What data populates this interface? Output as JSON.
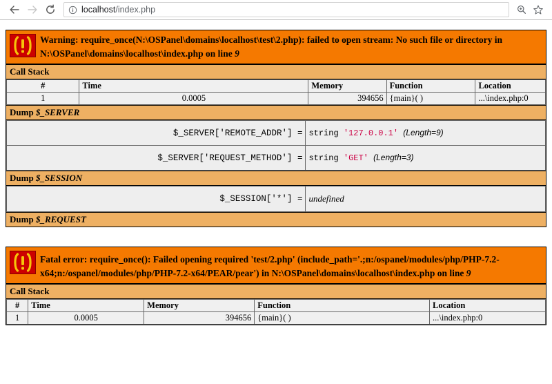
{
  "browser": {
    "back_label": "Back",
    "forward_label": "Forward",
    "reload_label": "Reload",
    "site_info_label": "View site information",
    "url_host": "localhost",
    "url_path": "/index.php",
    "zoom_icon_label": "Zoom",
    "bookmark_icon_label": "Bookmark this page"
  },
  "colors": {
    "error_banner_bg": "#f57900",
    "section_head_bg": "#eeb063",
    "icon_bg": "#cc0000",
    "icon_fg": "#f5c40a",
    "string_value": "#cc0044",
    "table_bg": "#f0f0f0"
  },
  "blocks": [
    {
      "id": "warning-block",
      "icon": "error-exclamation-icon",
      "message_prefix": "Warning: require_once(N:\\OSPanel\\domains\\localhost\\test\\2.php): failed to open stream: No such file or directory in N:\\OSPanel\\domains\\localhost\\index.php on line ",
      "message_line_number": "9",
      "call_stack_title": "Call Stack",
      "call_stack_columns": [
        "#",
        "Time",
        "Memory",
        "Function",
        "Location"
      ],
      "call_stack_rows": [
        {
          "num": "1",
          "time": "0.0005",
          "memory": "394656",
          "function": "{main}( )",
          "location": "...\\index.php:0"
        }
      ],
      "dumps": [
        {
          "title_prefix": "Dump ",
          "title_var": "$_SERVER",
          "rows": [
            {
              "key": "$_SERVER['REMOTE_ADDR'] =",
              "type": "string",
              "value": "'127.0.0.1'",
              "length": "(Length=9)",
              "undefined": ""
            },
            {
              "key": "$_SERVER['REQUEST_METHOD'] =",
              "type": "string",
              "value": "'GET'",
              "length": "(Length=3)",
              "undefined": ""
            }
          ]
        },
        {
          "title_prefix": "Dump ",
          "title_var": "$_SESSION",
          "rows": [
            {
              "key": "$_SESSION['*'] =",
              "type": "",
              "value": "",
              "length": "",
              "undefined": "undefined"
            }
          ]
        },
        {
          "title_prefix": "Dump ",
          "title_var": "$_REQUEST",
          "rows": []
        }
      ]
    },
    {
      "id": "fatal-block",
      "icon": "error-exclamation-icon",
      "message_prefix": "Fatal error: require_once(): Failed opening required 'test/2.php' (include_path='.;n:/ospanel/modules/php/PHP-7.2-x64;n:/ospanel/modules/php/PHP-7.2-x64/PEAR/pear') in N:\\OSPanel\\domains\\localhost\\index.php on line ",
      "message_line_number": "9",
      "call_stack_title": "Call Stack",
      "call_stack_columns": [
        "#",
        "Time",
        "Memory",
        "Function",
        "Location"
      ],
      "call_stack_rows": [
        {
          "num": "1",
          "time": "0.0005",
          "memory": "394656",
          "function": "{main}( )",
          "location": "...\\index.php:0"
        }
      ],
      "dumps": []
    }
  ]
}
